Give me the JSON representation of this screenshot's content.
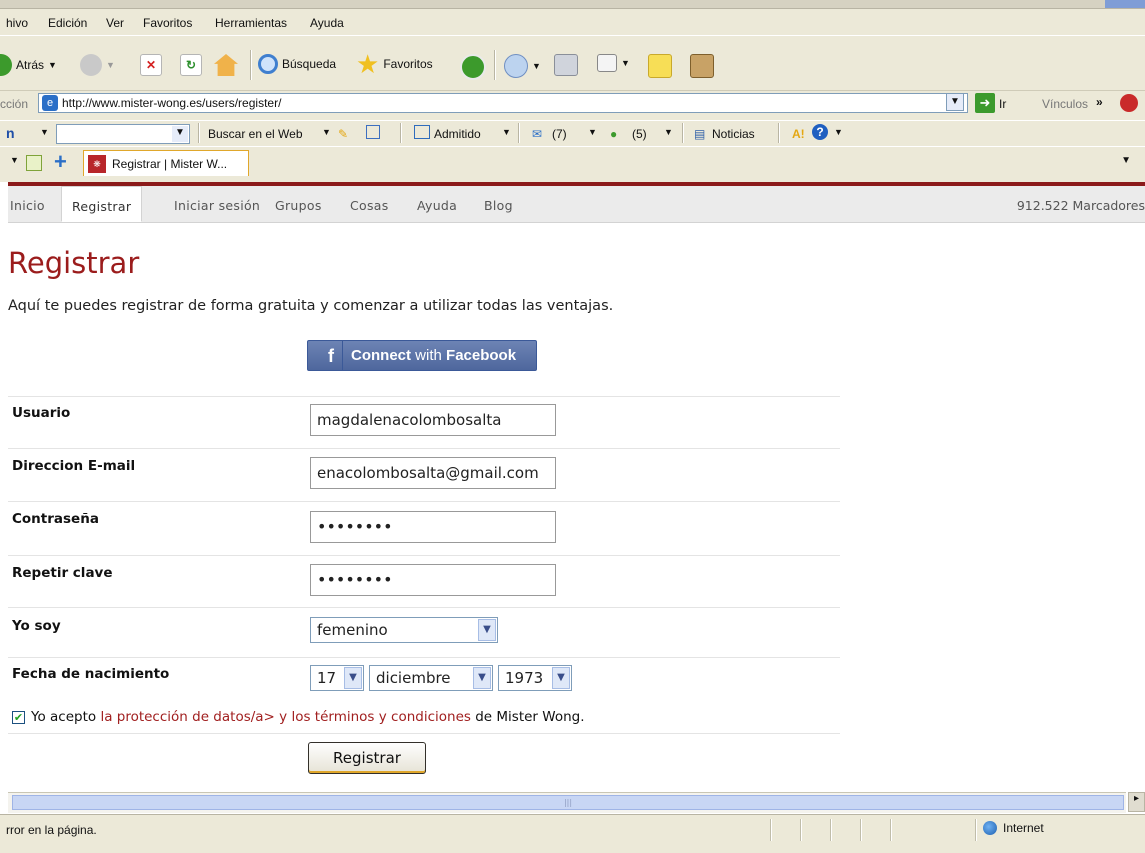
{
  "menu": [
    "hivo",
    "Edición",
    "Ver",
    "Favoritos",
    "Herramientas",
    "Ayuda"
  ],
  "toolbar": {
    "back": "Atrás",
    "search": "Búsqueda",
    "favorites": "Favoritos"
  },
  "address": {
    "label": "cción",
    "url": "http://www.mister-wong.es/users/register/",
    "go": "Ir",
    "links": "Vínculos"
  },
  "searchbar": {
    "web_search": "Buscar en el Web",
    "admitido": "Admitido",
    "mail_count": "(7)",
    "contacts_count": "(5)",
    "news": "Noticias"
  },
  "tab": {
    "title": "Registrar | Mister W..."
  },
  "site_nav": {
    "items": [
      "Inicio",
      "Registrar",
      "Iniciar sesión",
      "Grupos",
      "Cosas",
      "Ayuda",
      "Blog"
    ],
    "bookmarks": "912.522 Marcadores"
  },
  "page": {
    "title": "Registrar",
    "intro": "Aquí te puedes registrar de forma gratuita y comenzar a utilizar todas las ventajas.",
    "facebook_button": "Connect with Facebook",
    "facebook_connect": "Connect",
    "facebook_with": "with",
    "facebook_brand": "Facebook"
  },
  "form": {
    "username_label": "Usuario",
    "username_value": "magdalenacolombosalta",
    "email_label": "Direccion E-mail",
    "email_value": "enacolombosalta@gmail.com",
    "password_label": "Contraseña",
    "password_value": "••••••••",
    "repeat_label": "Repetir clave",
    "repeat_value": "••••••••",
    "gender_label": "Yo soy",
    "gender_value": "femenino",
    "birth_label": "Fecha de nacimiento",
    "birth_day": "17",
    "birth_month": "diciembre",
    "birth_year": "1973",
    "agree_prefix": "Yo acepto",
    "agree_link_privacy": "la protección de datos/a>",
    "agree_middle": "y los",
    "agree_link_terms": "términos y condiciones",
    "agree_suffix": "de Mister Wong.",
    "agree_checked": true,
    "submit": "Registrar"
  },
  "status": {
    "text": "rror en la página.",
    "zone": "Internet"
  },
  "colors": {
    "brand_red": "#9b1c1c",
    "facebook_blue": "#4e679d",
    "xp_chrome": "#ece9d8"
  }
}
